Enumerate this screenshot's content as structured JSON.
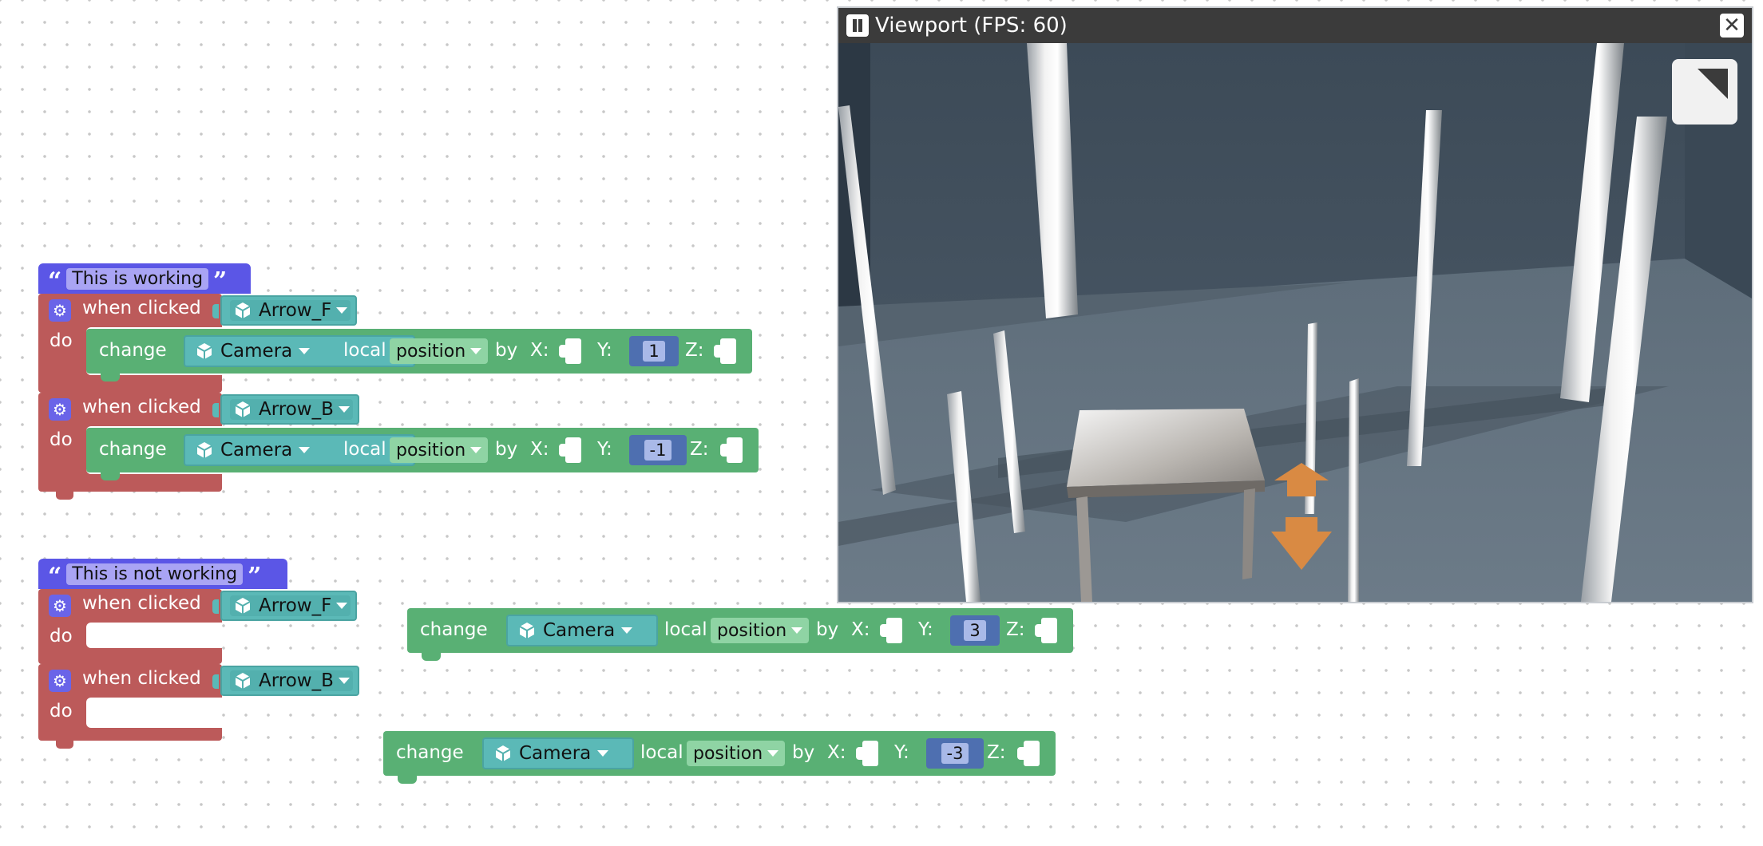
{
  "working_group": {
    "comment": "This is working",
    "event1": {
      "event_label": "when clicked",
      "do_label": "do",
      "target": "Arrow_F",
      "action": {
        "verb": "change",
        "object": "Camera",
        "space": "local",
        "property": "position",
        "by": "by",
        "x_label": "X:",
        "y_label": "Y:",
        "y_value": "1",
        "z_label": "Z:"
      }
    },
    "event2": {
      "event_label": "when clicked",
      "do_label": "do",
      "target": "Arrow_B",
      "action": {
        "verb": "change",
        "object": "Camera",
        "space": "local",
        "property": "position",
        "by": "by",
        "x_label": "X:",
        "y_label": "Y:",
        "y_value": "-1",
        "z_label": "Z:"
      }
    }
  },
  "not_working_group": {
    "comment": "This is not working",
    "event1": {
      "event_label": "when clicked",
      "do_label": "do",
      "target": "Arrow_F"
    },
    "event2": {
      "event_label": "when clicked",
      "do_label": "do",
      "target": "Arrow_B"
    }
  },
  "loose_blocks": [
    {
      "verb": "change",
      "object": "Camera",
      "space": "local",
      "property": "position",
      "by": "by",
      "x_label": "X:",
      "y_label": "Y:",
      "y_value": "3",
      "z_label": "Z:"
    },
    {
      "verb": "change",
      "object": "Camera",
      "space": "local",
      "property": "position",
      "by": "by",
      "x_label": "X:",
      "y_label": "Y:",
      "y_value": "-3",
      "z_label": "Z:"
    }
  ],
  "viewport": {
    "title": "Viewport (FPS: 60)",
    "pause_icon": "pause-icon",
    "close_icon": "close-icon",
    "fullscreen_icon": "fullscreen-icon"
  },
  "colors": {
    "comment": "#5b56e6",
    "event": "#bc5a5a",
    "object": "#5bb9b7",
    "change": "#59b074",
    "number": "#4e6fb0",
    "arrow": "#d98a43"
  }
}
